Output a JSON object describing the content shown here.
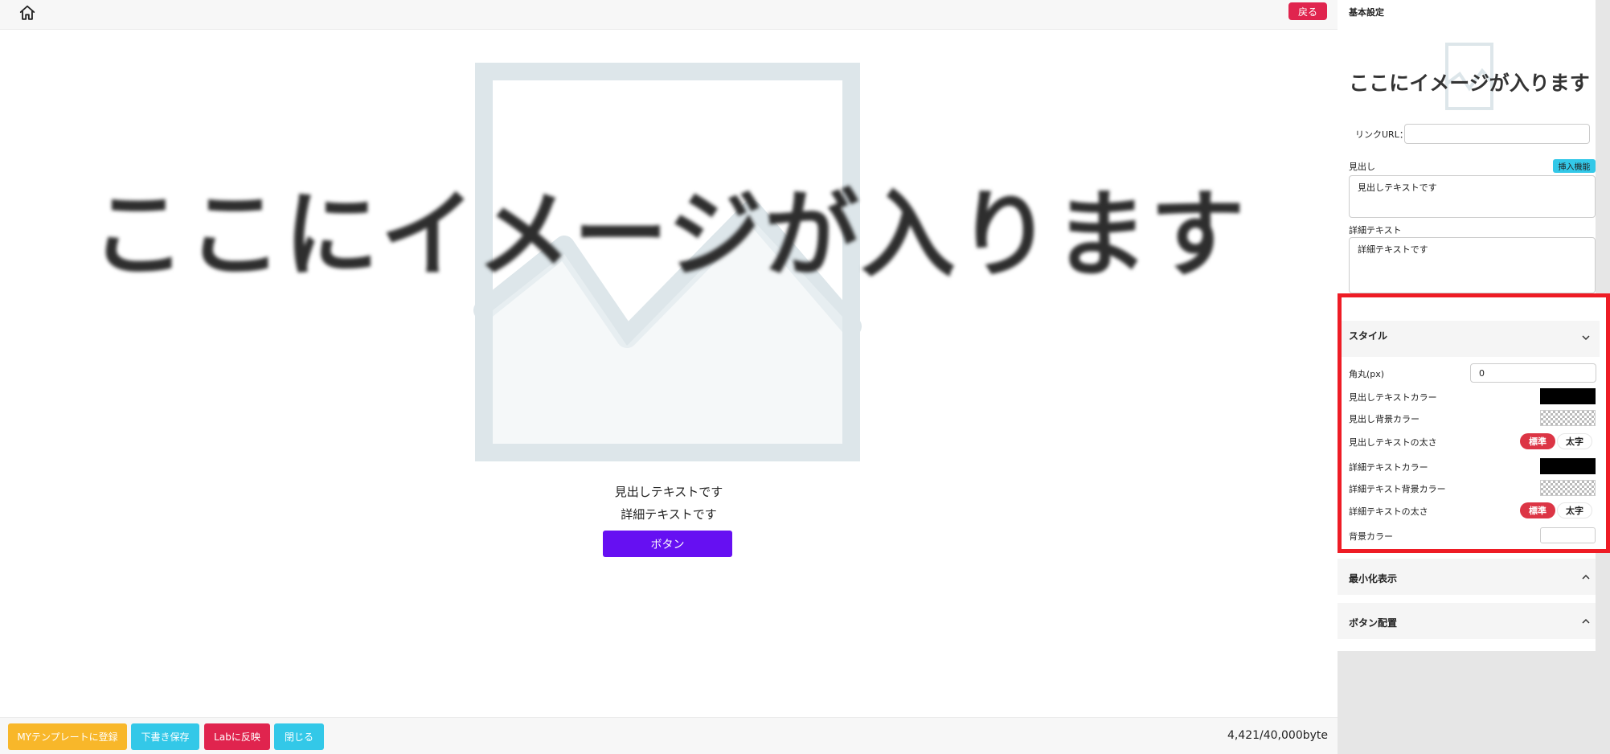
{
  "topbar": {
    "back_label": "戻る"
  },
  "preview": {
    "placeholder_text": "ここにイメージが入ります",
    "heading": "見出しテキストです",
    "detail": "詳細テキストです",
    "button_label": "ボタン"
  },
  "bottombar": {
    "mytemplate_label": "MYテンプレートに登録",
    "draft_label": "下書き保存",
    "lab_label": "Labに反映",
    "close_label": "閉じる",
    "byte_count": "4,421/40,000byte"
  },
  "panel": {
    "basic_title": "基本設定",
    "thumb_text": "ここにイメージが入ります",
    "link_label": "リンクURL：",
    "link_value": "",
    "heading_label": "見出し",
    "insert_label": "挿入機能",
    "heading_value": "見出しテキストです",
    "detail_label": "詳細テキスト",
    "detail_value": "詳細テキストです",
    "style": {
      "title": "スタイル",
      "radius_label": "角丸(px)",
      "radius_value": "0",
      "heading_color_label": "見出しテキストカラー",
      "heading_color": "#000000",
      "heading_bg_label": "見出し背景カラー",
      "heading_weight_label": "見出しテキストの太さ",
      "detail_color_label": "詳細テキストカラー",
      "detail_color": "#000000",
      "detail_bg_label": "詳細テキスト背景カラー",
      "detail_weight_label": "詳細テキストの太さ",
      "weight_normal": "標準",
      "weight_bold": "太字",
      "bg_color_label": "背景カラー",
      "bg_color": "#ffffff"
    },
    "minimize_title": "最小化表示",
    "button_layout_title": "ボタン配置"
  },
  "colors": {
    "back": "#e0244e",
    "preview_button": "#6610f2",
    "mytemplate": "#f8b72a",
    "draft": "#33c8e8",
    "lab": "#e0244e",
    "close": "#33c8e8",
    "highlight_border": "#ee1c25"
  }
}
